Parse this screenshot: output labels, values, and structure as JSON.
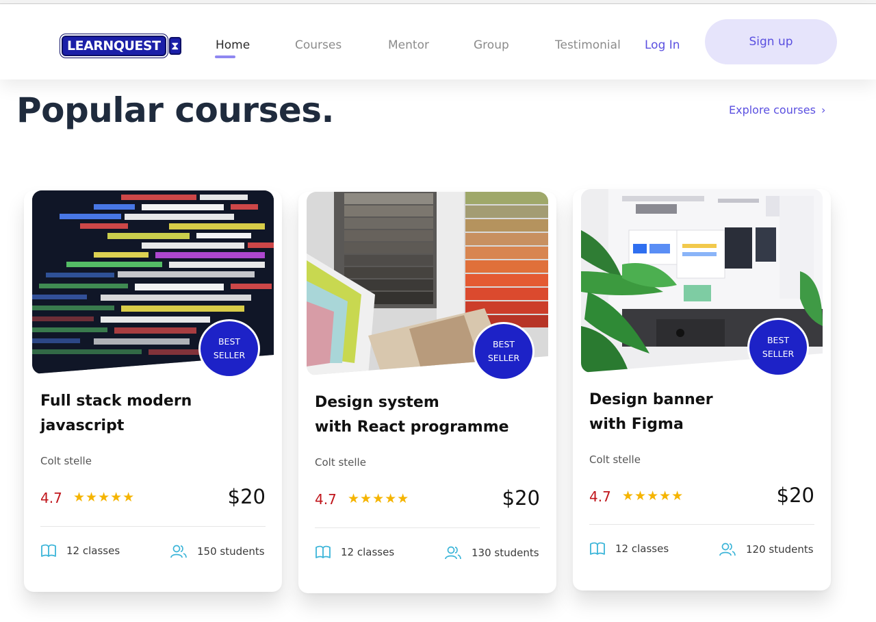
{
  "nav": {
    "logo_text": "LEARNQUEST",
    "links": [
      "Home",
      "Courses",
      "Mentor",
      "Group",
      "Testimonial"
    ],
    "login": "Log In",
    "signup": "Sign up"
  },
  "section": {
    "title": "Popular courses.",
    "explore_label": "Explore courses",
    "explore_arrow": "›"
  },
  "courses": [
    {
      "title_line1": "Full stack modern",
      "title_line2": "javascript",
      "author": "Colt stelle",
      "rating": "4.7",
      "stars": "★★★★★",
      "price": "$20",
      "classes": "12 classes",
      "students": "150 students",
      "badge_line1": "BEST",
      "badge_line2": "SELLER"
    },
    {
      "title_line1": "Design system",
      "title_line2": "with React programme",
      "author": "Colt stelle",
      "rating": "4.7",
      "stars": "★★★★★",
      "price": "$20",
      "classes": "12 classes",
      "students": "130 students",
      "badge_line1": "BEST",
      "badge_line2": "SELLER"
    },
    {
      "title_line1": "Design banner",
      "title_line2": "with Figma",
      "author": "Colt stelle",
      "rating": "4.7",
      "stars": "★★★★★",
      "price": "$20",
      "classes": "12 classes",
      "students": "120 students",
      "badge_line1": "BEST",
      "badge_line2": "SELLER"
    }
  ],
  "colors": {
    "accent": "#5a4fe0",
    "badge": "#1d22c7",
    "rating": "#c0151b",
    "stars": "#f5b400",
    "icon": "#3ab4d8"
  }
}
